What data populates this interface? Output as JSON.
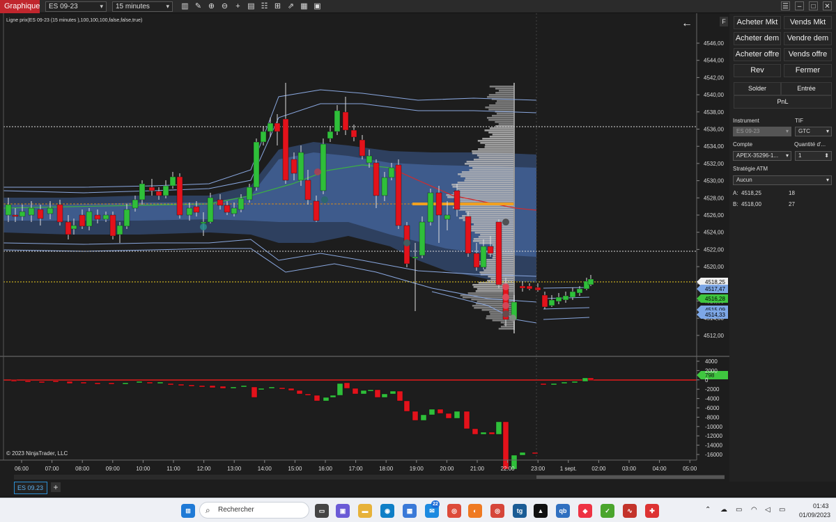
{
  "topbar": {
    "brand": "Graphique",
    "instrument": "ES 09-23",
    "interval": "15 minutes",
    "tool_icons": [
      "bar-chart-icon",
      "draw-icon",
      "zoom-in-icon",
      "zoom-out-icon",
      "crosshair-icon",
      "data-box-icon",
      "properties-icon",
      "indicator-icon",
      "strategy-icon",
      "templates-icon",
      "drawing-objects-icon"
    ]
  },
  "chart": {
    "title_line": "Ligne prix(ES 09-23 (15 minutes ),100,100,100,false,false,true)",
    "copyright": "© 2023 NinjaTrader, LLC",
    "price_axis": [
      "4546,00",
      "4544,00",
      "4542,00",
      "4540,00",
      "4538,00",
      "4536,00",
      "4534,00",
      "4532,00",
      "4530,00",
      "4528,00",
      "4526,00",
      "4524,00",
      "4522,00",
      "4520,00",
      "4518,00",
      "4516,00",
      "4514,00",
      "4512,00"
    ],
    "price_markers": [
      {
        "label": "4518,25",
        "color": "#f0f0f0",
        "text": "#000"
      },
      {
        "label": "4517,47",
        "color": "#7da7e6",
        "text": "#000"
      },
      {
        "label": "4516,28",
        "color": "#3fc63f",
        "text": "#000"
      },
      {
        "label": "4515,09",
        "color": "#7da7e6",
        "text": "#000"
      },
      {
        "label": "4514,33",
        "color": "#7da7e6",
        "text": "#000"
      }
    ],
    "indicator_axis": [
      "4000",
      "2000",
      "0",
      "-2000",
      "-4000",
      "-6000",
      "-8000",
      "-10000",
      "-12000",
      "-14000",
      "-16000"
    ],
    "indicator_marker": "798",
    "time_axis": [
      "06:00",
      "07:00",
      "08:00",
      "09:00",
      "10:00",
      "11:00",
      "12:00",
      "13:00",
      "14:00",
      "15:00",
      "16:00",
      "17:00",
      "18:00",
      "19:00",
      "20:00",
      "21:00",
      "22:00",
      "23:00",
      "1 sept.",
      "02:00",
      "03:00",
      "04:00",
      "05:00"
    ]
  },
  "sidebar": {
    "buttons": [
      [
        "Acheter Mkt",
        "Vends Mkt"
      ],
      [
        "Acheter dem",
        "Vendre dem"
      ],
      [
        "Acheter offre",
        "Vends offre"
      ],
      [
        "Rev",
        "Fermer"
      ]
    ],
    "solder": "Solder",
    "entree": "Entrée",
    "pnl": "PnL",
    "instrument_label": "Instrument",
    "instrument_value": "ES 09-23",
    "tif_label": "TIF",
    "tif_value": "GTC",
    "compte_label": "Compte",
    "compte_value": "APEX-35296-1...",
    "quantite_label": "Quantité d'...",
    "quantite_value": "1",
    "atm_label": "Stratégie ATM",
    "atm_value": "Aucun",
    "ask_label": "A:",
    "ask_price": "4518,25",
    "ask_size": "18",
    "bid_label": "B:",
    "bid_price": "4518,00",
    "bid_size": "27"
  },
  "tabs": {
    "active": "ES 09.23",
    "add": "+"
  },
  "taskbar": {
    "search_placeholder": "Rechercher",
    "badge": "22",
    "time": "01:43",
    "date": "01/09/2023",
    "win_ctrls": [
      "☰",
      "–",
      "□",
      "✕"
    ]
  }
}
